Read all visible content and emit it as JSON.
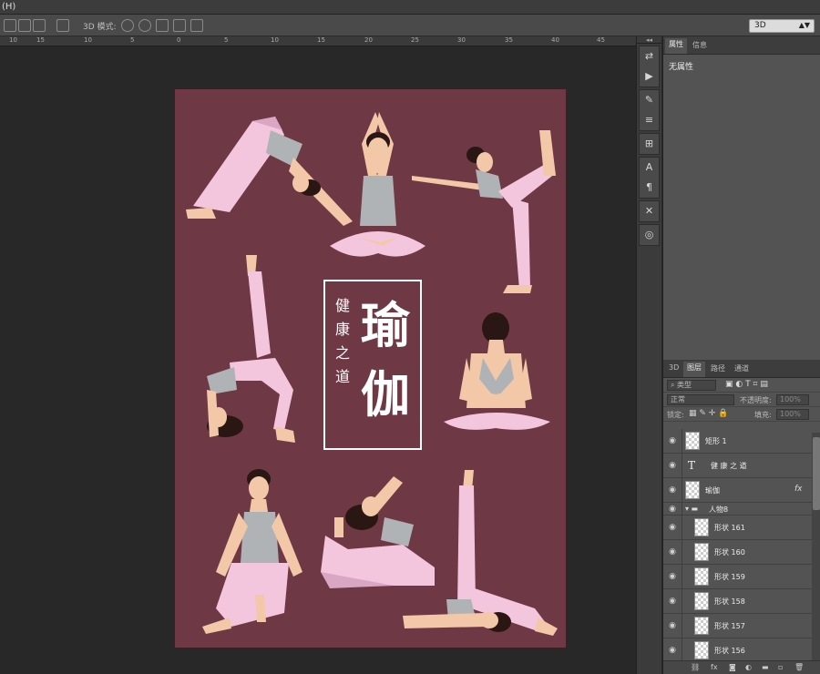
{
  "menu": {
    "item": "(H)"
  },
  "options_bar": {
    "mode_label": "3D 模式:",
    "dropdown_value": "3D"
  },
  "ruler": {
    "labels": [
      "10",
      "15",
      "10",
      "5",
      "0",
      "5",
      "10",
      "15",
      "20",
      "25",
      "30",
      "35",
      "40",
      "45"
    ]
  },
  "poster": {
    "title_large_1": "瑜",
    "title_large_2": "伽",
    "subtitle_chars": [
      "健",
      "康",
      "之",
      "道"
    ]
  },
  "properties_panel": {
    "tabs": [
      "属性",
      "信息"
    ],
    "content": "无属性"
  },
  "layers_panel": {
    "tabs": [
      "3D",
      "图层",
      "路径",
      "通道"
    ],
    "filter_kind": "类型",
    "blend_mode": "正常",
    "opacity_label": "不透明度:",
    "opacity_value": "100%",
    "lock_label": "锁定:",
    "fill_label": "填充:",
    "fill_value": "100%",
    "layers": [
      {
        "name": "矩形 1",
        "type": "shape"
      },
      {
        "name": "健 康 之 道",
        "type": "text"
      },
      {
        "name": "瑜伽",
        "type": "shape",
        "fx": "fx"
      },
      {
        "name": "人物8",
        "type": "group"
      },
      {
        "name": "形状 161",
        "type": "shape"
      },
      {
        "name": "形状 160",
        "type": "shape"
      },
      {
        "name": "形状 159",
        "type": "shape"
      },
      {
        "name": "形状 158",
        "type": "shape"
      },
      {
        "name": "形状 157",
        "type": "shape"
      },
      {
        "name": "形状 156",
        "type": "shape"
      }
    ]
  },
  "colors": {
    "poster_bg": "#6e3844",
    "skin": "#f2c8a8",
    "pants": "#f3c6de",
    "top": "#b0b3b6",
    "hair": "#2a1612"
  }
}
